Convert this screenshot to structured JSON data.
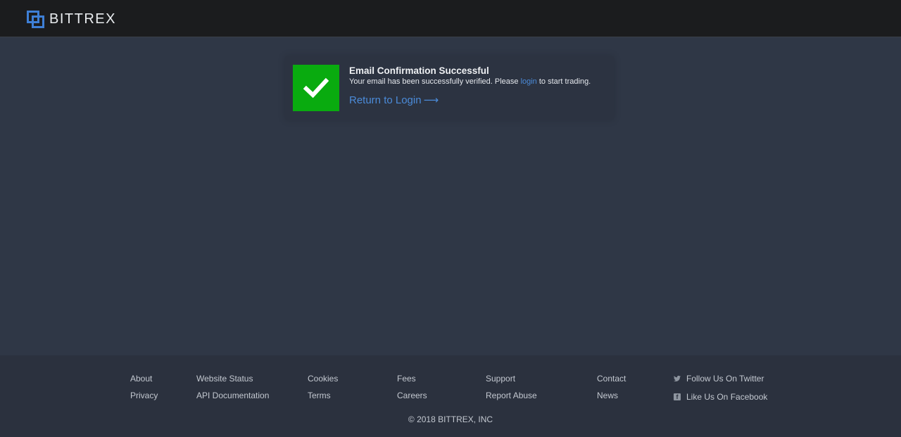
{
  "header": {
    "brand": "BITTREX",
    "colors": {
      "background": "#1b1c1e",
      "logo": "#3e7fd6"
    }
  },
  "confirmation": {
    "icon": "checkmark-icon",
    "title": "Email Confirmation Successful",
    "message_before": "Your email has been successfully verified. Please ",
    "message_link": "login",
    "message_after": " to start trading.",
    "return_label": "Return to Login",
    "return_arrow": "⟶",
    "colors": {
      "success": "#09ab0f",
      "link": "#4b8bd9"
    }
  },
  "footer": {
    "links": {
      "about": "About",
      "privacy": "Privacy",
      "website_status": "Website Status",
      "api_documentation": "API Documentation",
      "cookies": "Cookies",
      "terms": "Terms",
      "fees": "Fees",
      "careers": "Careers",
      "support": "Support",
      "report_abuse": "Report Abuse",
      "contact": "Contact",
      "news": "News"
    },
    "social": {
      "twitter": "Follow Us On Twitter",
      "facebook": "Like Us On Facebook"
    },
    "copyright": "© 2018 BITTREX, INC"
  }
}
